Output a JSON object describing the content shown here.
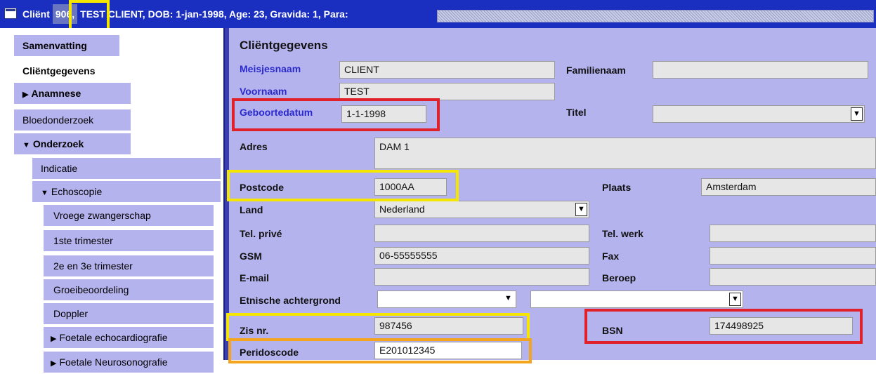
{
  "titlebar": {
    "pre": "Cliënt",
    "num": "906,",
    "rest": "TEST CLIENT, DOB: 1-jan-1998, Age: 23, Gravida: 1, Para:"
  },
  "sidebar": {
    "samenvatting": "Samenvatting",
    "clientgegevens": "Cliëntgegevens",
    "anamnese": "Anamnese",
    "bloedonderzoek": "Bloedonderzoek",
    "onderzoek": "Onderzoek",
    "indicatie": "Indicatie",
    "echoscopie": "Echoscopie",
    "vroege": "Vroege zwangerschap",
    "trim1": "1ste trimester",
    "trim23": "2e en 3e trimester",
    "groei": "Groeibeoordeling",
    "doppler": "Doppler",
    "foetaal_echo": "Foetale echocardiografie",
    "foetaal_neuro": "Foetale Neurosonografie"
  },
  "form": {
    "heading": "Cliëntgegevens",
    "meisjesnaam": {
      "label": "Meisjesnaam",
      "value": "CLIENT"
    },
    "familienaam": {
      "label": "Familienaam",
      "value": ""
    },
    "voornaam": {
      "label": "Voornaam",
      "value": "TEST"
    },
    "geboortedatum": {
      "label": "Geboortedatum",
      "value": "1-1-1998"
    },
    "titel": {
      "label": "Titel",
      "value": ""
    },
    "adres": {
      "label": "Adres",
      "value": "DAM 1"
    },
    "postcode": {
      "label": "Postcode",
      "value": "1000AA"
    },
    "plaats": {
      "label": "Plaats",
      "value": "Amsterdam"
    },
    "land": {
      "label": "Land",
      "value": "Nederland"
    },
    "tel_prive": {
      "label": "Tel. privé",
      "value": ""
    },
    "tel_werk": {
      "label": "Tel. werk",
      "value": ""
    },
    "gsm": {
      "label": "GSM",
      "value": "06-55555555"
    },
    "fax": {
      "label": "Fax",
      "value": ""
    },
    "email": {
      "label": "E-mail",
      "value": ""
    },
    "beroep": {
      "label": "Beroep",
      "value": ""
    },
    "etnische": {
      "label": "Etnische achtergrond",
      "value1": "",
      "value2": ""
    },
    "zis": {
      "label": "Zis nr.",
      "value": "987456"
    },
    "bsn": {
      "label": "BSN",
      "value": "174498925"
    },
    "peridos": {
      "label": "Peridoscode",
      "value": "E201012345"
    }
  },
  "icons": {
    "dropdown": "▼",
    "collapsed": "▶",
    "expanded": "▼"
  },
  "colors": {
    "titlebar": "#1a2fc0",
    "panel": "#b5b3ee",
    "label_blue": "#2a2acc",
    "highlight_red": "#e0212a",
    "highlight_yellow": "#f5e600",
    "highlight_orange": "#f4a520"
  }
}
